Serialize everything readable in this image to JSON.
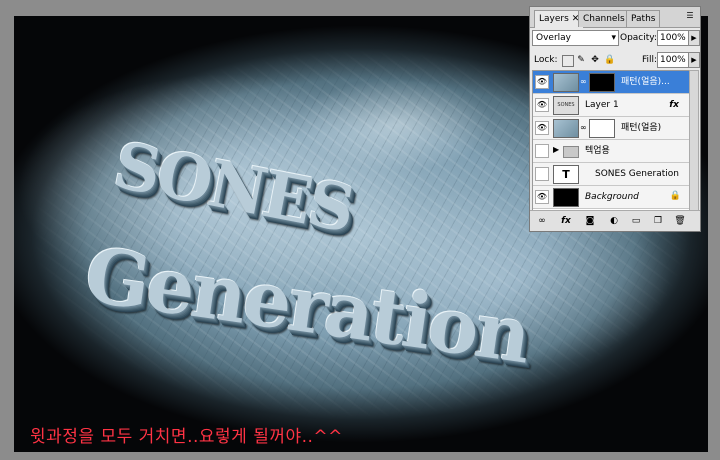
{
  "canvas": {
    "title_line1": "SONES",
    "title_line2": "Generation",
    "caption": "윗과정을 모두 거치면..요렇게 될꺼야..^^"
  },
  "layers_panel": {
    "tabs": [
      {
        "label": "Layers",
        "active": true
      },
      {
        "label": "Channels",
        "active": false
      },
      {
        "label": "Paths",
        "active": false
      }
    ],
    "blend_mode": "Overlay",
    "opacity_label": "Opacity:",
    "opacity_value": "100%",
    "lock_label": "Lock:",
    "fill_label": "Fill:",
    "fill_value": "100%",
    "layers": [
      {
        "name": "패턴(얼음)...",
        "selected": true,
        "visible": true
      },
      {
        "name": "Layer 1",
        "selected": false,
        "visible": true,
        "fx": "fx"
      },
      {
        "name": "패턴(얼음)",
        "selected": false,
        "visible": true
      },
      {
        "name": "텍업용",
        "selected": false,
        "visible": false,
        "type": "group"
      },
      {
        "name": "SONES  Generation",
        "selected": false,
        "visible": false,
        "type": "text",
        "thumb_text": "T"
      },
      {
        "name": "Background",
        "selected": false,
        "visible": true,
        "locked": true
      }
    ]
  },
  "colors": {
    "selected_layer": "#3a7fd8",
    "caption_red": "#ff3344"
  }
}
